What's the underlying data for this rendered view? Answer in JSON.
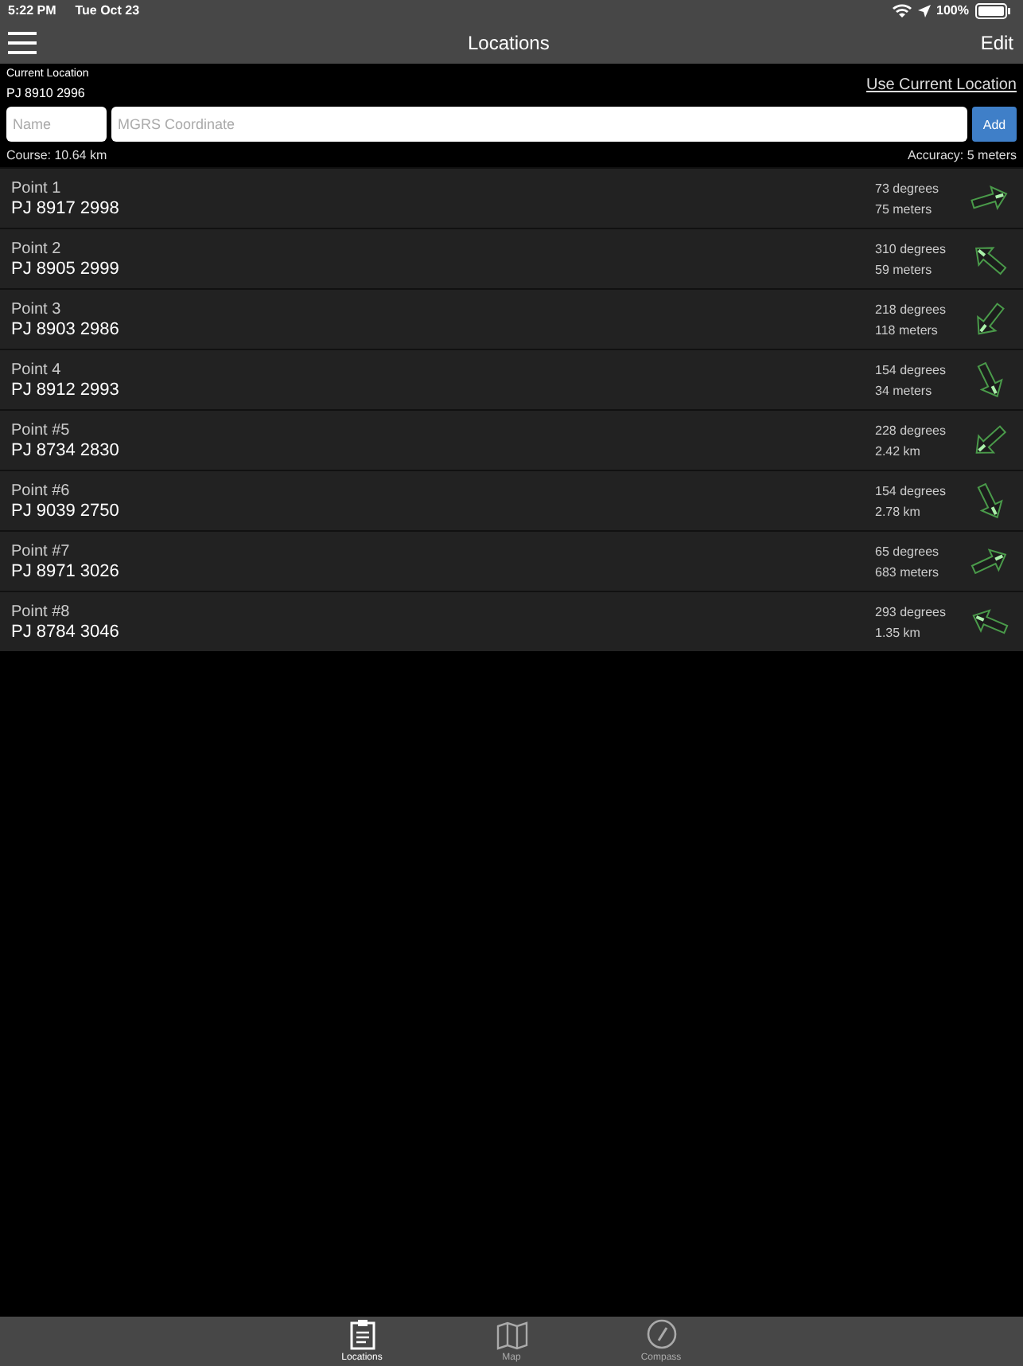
{
  "status_bar": {
    "time": "5:22 PM",
    "date": "Tue Oct 23",
    "battery": "100%"
  },
  "nav_bar": {
    "title": "Locations",
    "edit": "Edit"
  },
  "current_location": {
    "label": "Current Location",
    "value": "PJ 8910 2996",
    "use_link": "Use Current Location"
  },
  "form": {
    "name_placeholder": "Name",
    "coordinate_placeholder": "MGRS Coordinate",
    "add": "Add"
  },
  "info": {
    "course": "Course: 10.64 km",
    "accuracy": "Accuracy: 5 meters"
  },
  "points": [
    {
      "name": "Point 1",
      "coordinate": "PJ 8917 2998",
      "bearing": "73 degrees",
      "distance": "75 meters"
    },
    {
      "name": "Point 2",
      "coordinate": "PJ 8905 2999",
      "bearing": "310 degrees",
      "distance": "59 meters"
    },
    {
      "name": "Point 3",
      "coordinate": "PJ 8903 2986",
      "bearing": "218 degrees",
      "distance": "118 meters"
    },
    {
      "name": "Point 4",
      "coordinate": "PJ 8912 2993",
      "bearing": "154 degrees",
      "distance": "34 meters"
    },
    {
      "name": "Point #5",
      "coordinate": "PJ 8734 2830",
      "bearing": "228 degrees",
      "distance": "2.42 km"
    },
    {
      "name": "Point #6",
      "coordinate": "PJ 9039 2750",
      "bearing": "154 degrees",
      "distance": "2.78 km"
    },
    {
      "name": "Point #7",
      "coordinate": "PJ 8971 3026",
      "bearing": "65 degrees",
      "distance": "683 meters"
    },
    {
      "name": "Point #8",
      "coordinate": "PJ 8784 3046",
      "bearing": "293 degrees",
      "distance": "1.35 km"
    }
  ],
  "tab_bar": [
    {
      "kind": "clipboard",
      "label": "Locations",
      "selected": true
    },
    {
      "kind": "map",
      "label": "Map",
      "selected": false
    },
    {
      "kind": "compass",
      "label": "Compass",
      "selected": false
    }
  ]
}
